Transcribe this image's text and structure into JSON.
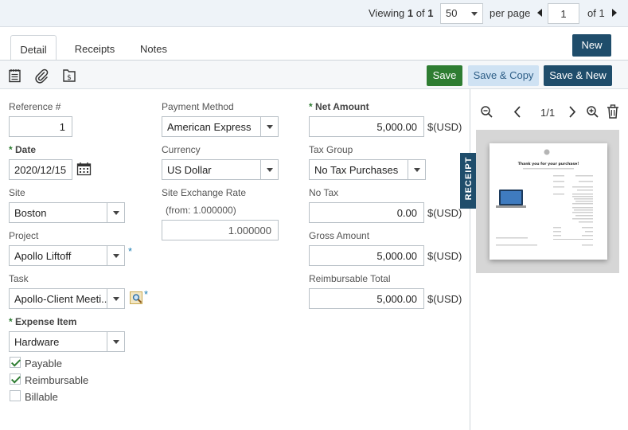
{
  "pager": {
    "viewing_prefix": "Viewing",
    "current": "1",
    "of_word": "of",
    "total": "1",
    "per_page_value": "50",
    "per_page_label": "per page",
    "page_value": "1",
    "page_of": "of 1"
  },
  "tabs": [
    {
      "label": "Detail",
      "active": true
    },
    {
      "label": "Receipts",
      "active": false
    },
    {
      "label": "Notes",
      "active": false
    }
  ],
  "buttons": {
    "new": "New",
    "save": "Save",
    "save_copy": "Save & Copy",
    "save_new": "Save & New"
  },
  "form": {
    "reference": {
      "label": "Reference #",
      "value": "1"
    },
    "date": {
      "label": "Date",
      "value": "2020/12/15"
    },
    "site": {
      "label": "Site",
      "value": "Boston"
    },
    "project": {
      "label": "Project",
      "value": "Apollo Liftoff"
    },
    "task": {
      "label": "Task",
      "value": "Apollo-Client Meeti..."
    },
    "expense_item": {
      "label": "Expense Item",
      "value": "Hardware"
    },
    "payment_method": {
      "label": "Payment Method",
      "value": "American Express"
    },
    "currency": {
      "label": "Currency",
      "value": "US Dollar"
    },
    "exchange_rate": {
      "label": "Site Exchange Rate",
      "from_text": "(from: 1.000000)",
      "value": "1.000000"
    },
    "net_amount": {
      "label": "Net Amount",
      "value": "5,000.00",
      "unit": "$(USD)"
    },
    "tax_group": {
      "label": "Tax Group",
      "value": "No Tax Purchases"
    },
    "no_tax": {
      "label": "No Tax",
      "value": "0.00",
      "unit": "$(USD)"
    },
    "gross_amount": {
      "label": "Gross Amount",
      "value": "5,000.00",
      "unit": "$(USD)"
    },
    "reimbursable_total": {
      "label": "Reimbursable Total",
      "value": "5,000.00",
      "unit": "$(USD)"
    },
    "checkboxes": [
      {
        "label": "Payable",
        "checked": true
      },
      {
        "label": "Reimbursable",
        "checked": true
      },
      {
        "label": "Billable",
        "checked": false
      }
    ],
    "required_star": "*"
  },
  "preview": {
    "page_indicator": "1/1",
    "tab_label": "RECEIPT",
    "receipt_heading": "Thank you for your purchase!"
  },
  "colors": {
    "accent_dark": "#1f4d6b",
    "save_green": "#2e7d32",
    "save_copy_light": "#cfe2f3"
  }
}
